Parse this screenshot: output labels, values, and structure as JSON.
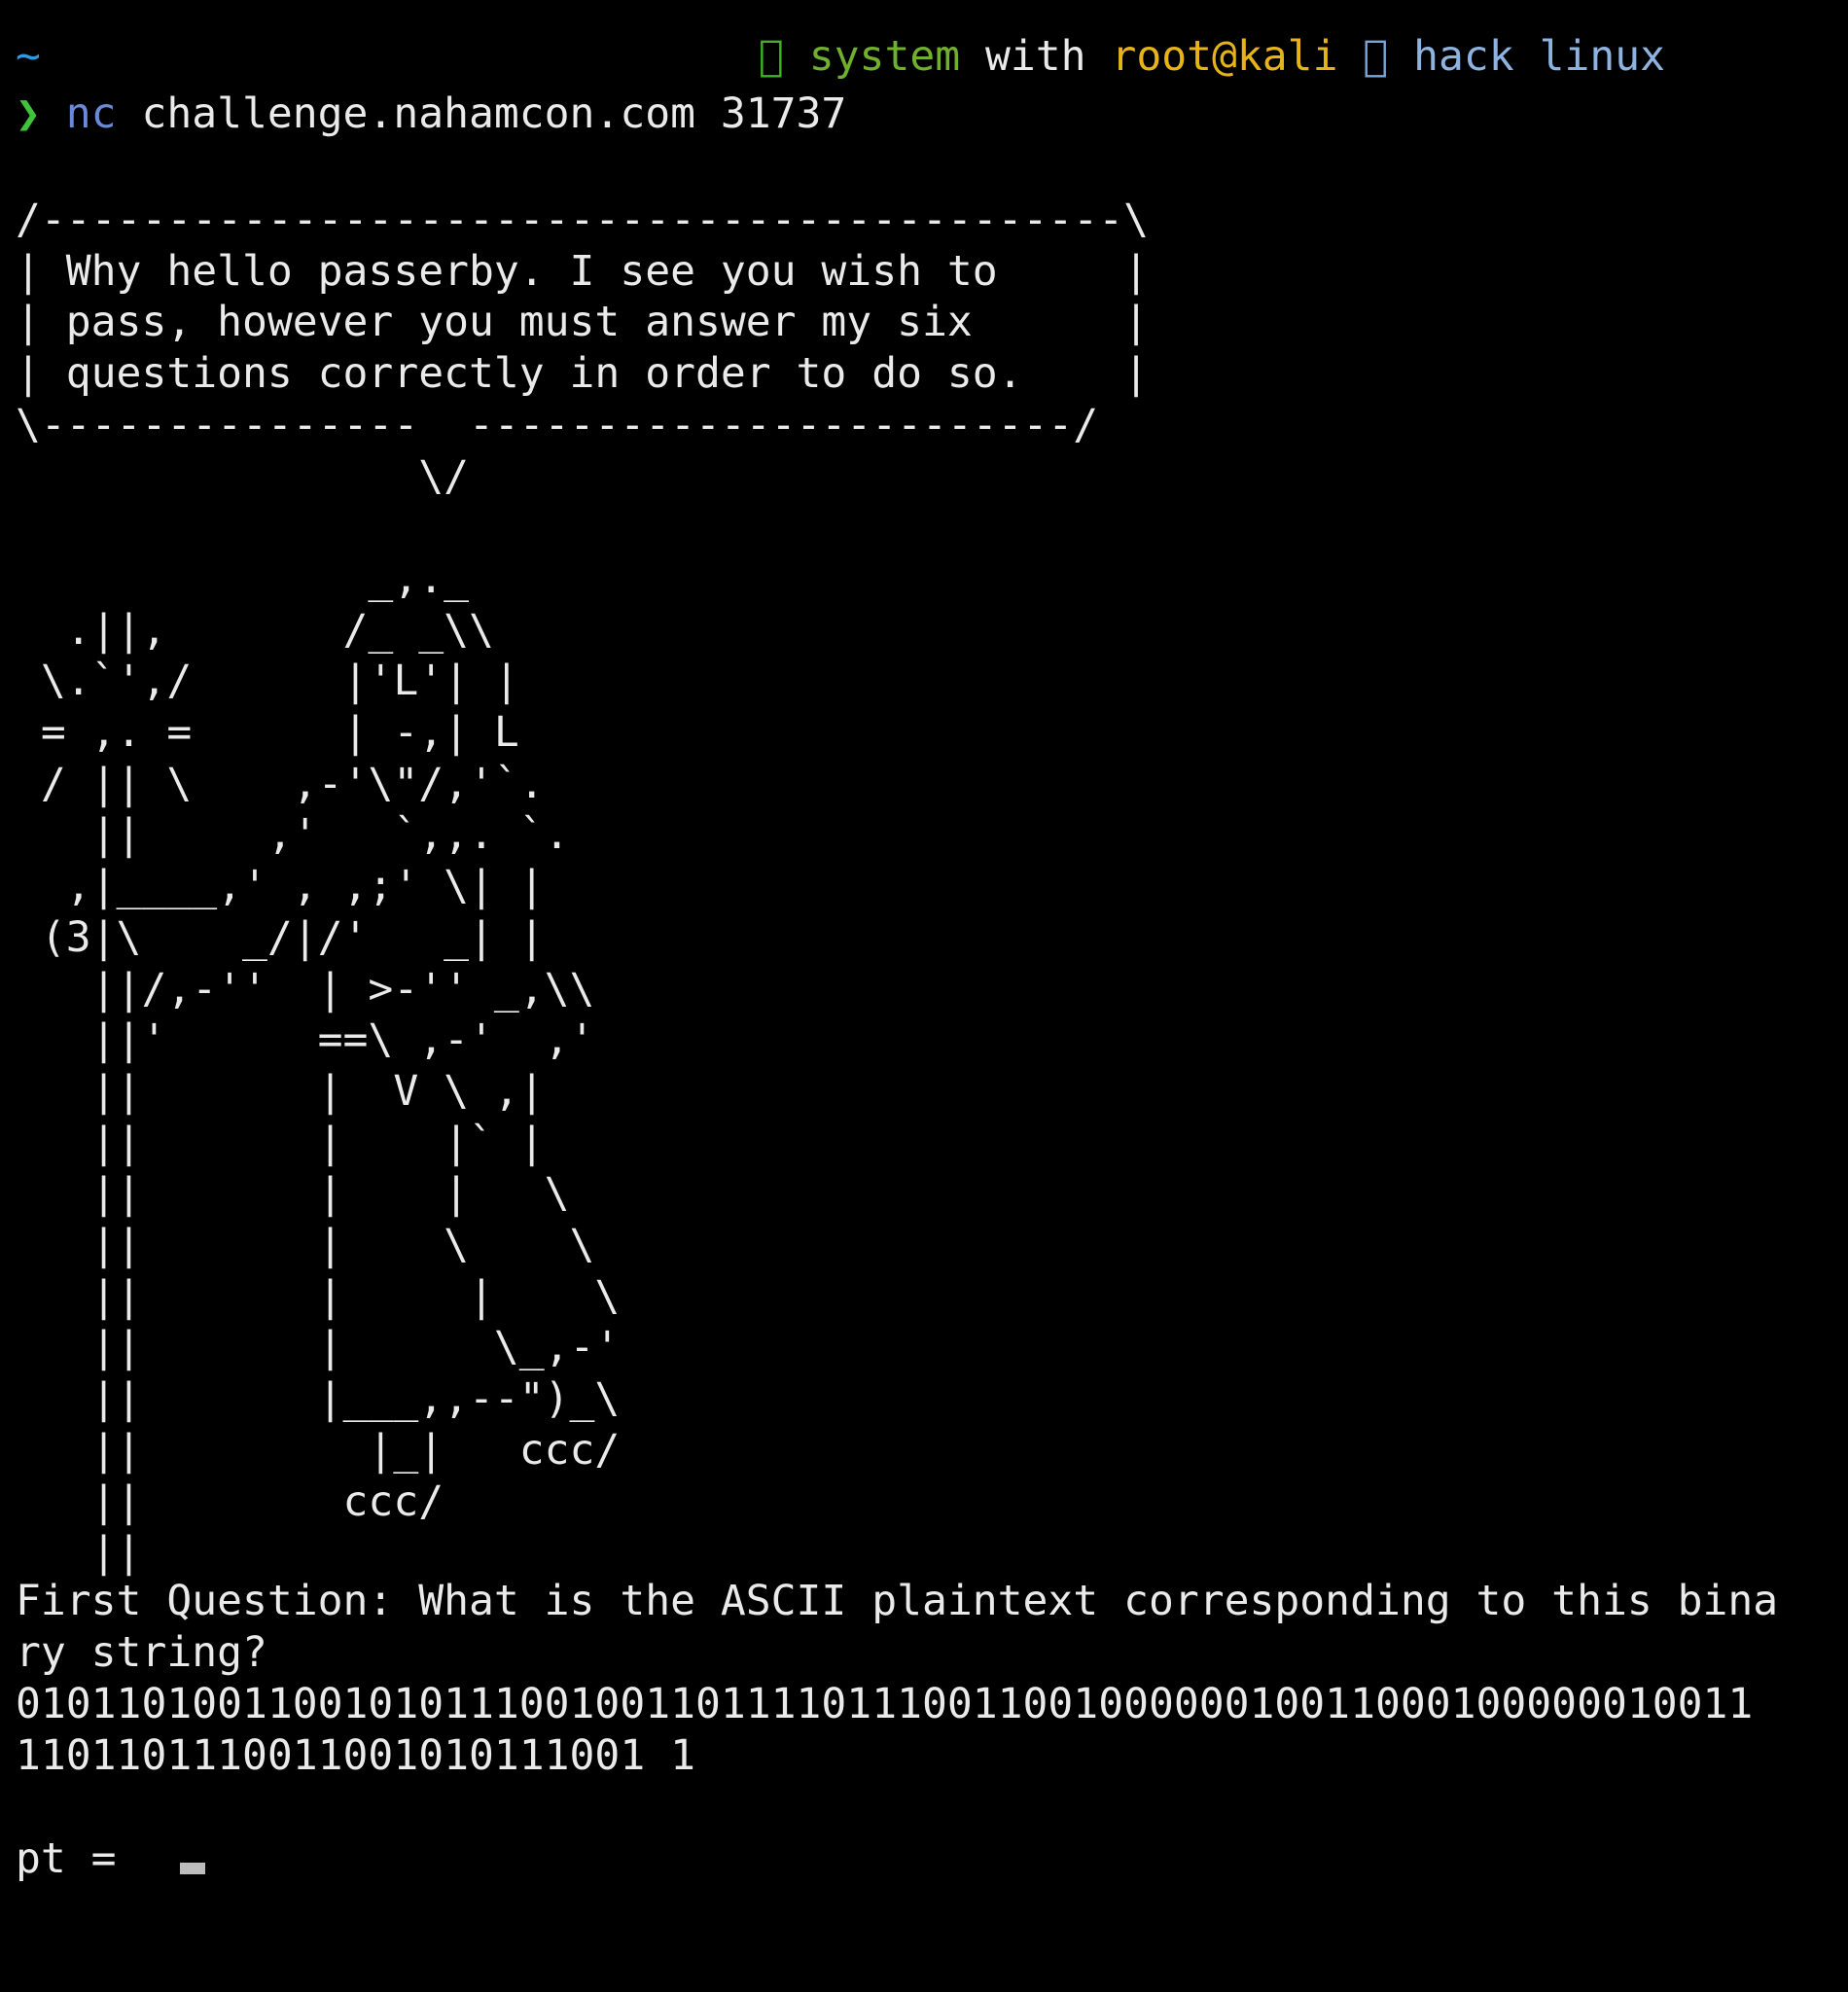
{
  "prompt": {
    "cwd_symbol": "~",
    "segments": {
      "system_icon": "",
      "system_label": "system",
      "with_label": "with",
      "user_host": "root@kali",
      "dir_icon": "",
      "dir_label_1": "hack",
      "dir_label_2": "linux"
    },
    "arrow": "❯",
    "command": "nc",
    "command_args": "challenge.nahamcon.com 31737"
  },
  "banner": {
    "ascii_art": "/-------------------------------------------\\\n| Why hello passerby. I see you wish to     |\n| pass, however you must answer my six      |\n| questions correctly in order to do so.    |\n\\---------------  ------------------------/\n                \\/\n\n              _,._\n  .||,       /_ _\\\\\n \\.`',/      |'L'| |\n = ,. =      | -,| L\n / || \\    ,-'\\\"/,'`.\n   ||     ,'   `,,. `.\n  ,|____,' , ,;' \\| |\n (3|\\    _/|/'   _| |\n   ||/,-''  | >-'' _,\\\\\n   ||'      ==\\ ,-'  ,'\n   ||       |  V \\ ,|\n   ||       |    |` |\n   ||       |    |   \\\n   ||       |    \\    \\\n   ||       |     |    \\\n   ||       |      \\_,-'\n   ||       |___,,--\")_\\\n   ||         |_|   ccc/\n   ||        ccc/\n   ||"
  },
  "question": {
    "text": "First Question: What is the ASCII plaintext corresponding to this bina\nry string?",
    "binary": "010110100110010101110010011011110111001100100000010011000100000010011\n1101101110011001010111001 1"
  },
  "input": {
    "label": "pt = ",
    "value": ""
  },
  "colors": {
    "background": "#000000",
    "foreground": "#eaeaea",
    "tilde": "#2f9be0",
    "system": "#6fb02e",
    "user_host": "#e6b417",
    "dir": "#8fb3e0",
    "prompt_arrow": "#3ec43a",
    "command": "#6a8ad8"
  }
}
